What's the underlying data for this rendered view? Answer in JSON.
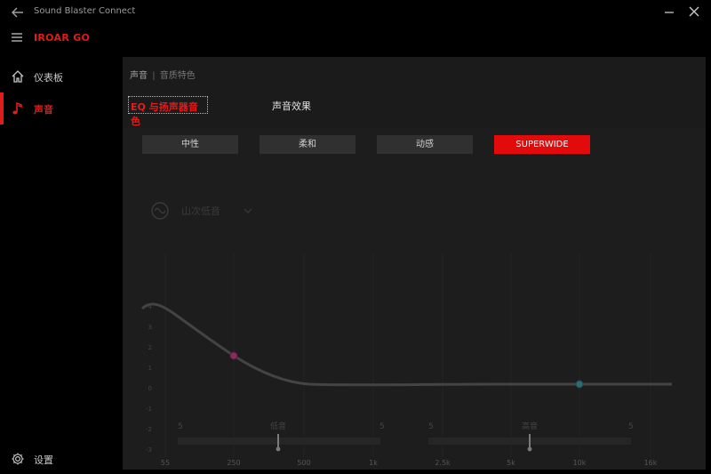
{
  "app": {
    "title": "Sound Blaster Connect",
    "device": "IROAR GO"
  },
  "sidebar": {
    "items": [
      {
        "label": "仪表板",
        "icon": "home-icon"
      },
      {
        "label": "声音",
        "icon": "music-note-icon"
      }
    ],
    "settings": {
      "label": "设置",
      "icon": "gear-icon"
    }
  },
  "main": {
    "breadcrumb": {
      "section": "声音",
      "separator": "|",
      "sub": "音质特色"
    },
    "tabs": [
      {
        "label": "EQ 与扬声器音色"
      },
      {
        "label": "声音效果"
      }
    ],
    "presets": [
      {
        "label": "中性"
      },
      {
        "label": "柔和"
      },
      {
        "label": "动感"
      },
      {
        "label": "SUPERWIDE"
      }
    ],
    "selected_preset": "SUPERWIDE",
    "band_selector": {
      "label": "山次低音",
      "icon": "wave-icon"
    },
    "y_ticks": [
      "4",
      "3",
      "2",
      "1",
      "0",
      "-1",
      "-2",
      "-3"
    ],
    "x_ticks": [
      "55",
      "250",
      "500",
      "1k",
      "2.5k",
      "5k",
      "10k",
      "16k"
    ],
    "sliders": [
      {
        "label": "低音",
        "min": "5",
        "max": "5"
      },
      {
        "label": "高音",
        "min": "5",
        "max": "5"
      }
    ]
  },
  "colors": {
    "accent": "#e21b1b",
    "background": "#000000",
    "panel": "#1b1b1b",
    "preset_bg": "#303030",
    "node_low": "#8a2d5c",
    "node_high": "#2c6b72"
  }
}
